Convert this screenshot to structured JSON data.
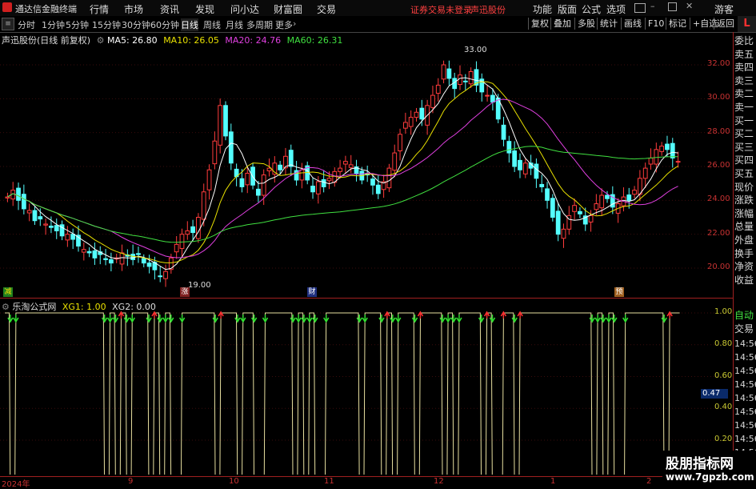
{
  "titlebar": {
    "app_name": "通达信金融终端",
    "menus": [
      "行情",
      "市场",
      "资讯",
      "发现",
      "问小达",
      "财富圈",
      "交易"
    ],
    "notice": "证券交易未登录",
    "stock_name": "声迅股份",
    "right_menus": [
      "功能",
      "版面",
      "公式",
      "选项"
    ],
    "user": "游客",
    "colors": {
      "notice": "#ff4040",
      "accent": "#ff3030"
    }
  },
  "toolbar": {
    "periods": [
      "分时",
      "1分钟",
      "5分钟",
      "15分钟",
      "30分钟",
      "60分钟",
      "日线",
      "周线",
      "月线",
      "多周期",
      "更多"
    ],
    "selected_period": "日线",
    "right_buttons": [
      "复权",
      "叠加",
      "多股",
      "统计",
      "画线",
      "F10",
      "标记",
      "+自选",
      "返回"
    ]
  },
  "main_chart": {
    "title": "声迅股份(日线 前复权)",
    "ma": [
      {
        "label": "MA5: 26.80",
        "color": "#ffffff"
      },
      {
        "label": "MA10: 26.05",
        "color": "#e8e000"
      },
      {
        "label": "MA20: 24.76",
        "color": "#e040e0"
      },
      {
        "label": "MA60: 26.31",
        "color": "#40e040"
      }
    ],
    "high_label": "33.00",
    "low_label": "19.00",
    "markers": [
      "减",
      "涨",
      "财",
      "预"
    ],
    "y_ticks": [
      "32.00",
      "30.00",
      "28.00",
      "26.00",
      "24.00",
      "22.00",
      "20.00"
    ]
  },
  "sub_chart": {
    "title": "乐淘公式网",
    "xg1": "XG1: 1.00",
    "xg2": "XG2: 0.00",
    "y_ticks": [
      "1.00",
      "0.80",
      "0.60",
      "0.40",
      "0.20"
    ],
    "cursor_value": "0.47"
  },
  "x_axis": [
    "2024年",
    "9",
    "10",
    "11",
    "12",
    "1",
    "2"
  ],
  "right_panel": {
    "labels": [
      "委比",
      "卖五",
      "卖四",
      "卖三",
      "卖二",
      "卖一",
      "买一",
      "买二",
      "买三",
      "买四",
      "买五",
      "现价",
      "涨跌",
      "涨幅",
      "总量",
      "外盘",
      "换手",
      "净资",
      "收益"
    ],
    "sub_labels": [
      "自动",
      "交易"
    ],
    "times": [
      "14:56",
      "14:56",
      "14:56",
      "14:56",
      "14:56",
      "14:56",
      "14:56",
      "14:56",
      "14:56",
      "14:56"
    ],
    "corner": "L"
  },
  "watermark": {
    "text": "股朋指标网",
    "url": "www.7gpzb.com"
  },
  "chart_data": [
    {
      "type": "candlestick",
      "title": "",
      "ylim": [
        19.0,
        33.5
      ],
      "close": [
        24.2,
        24.6,
        24.0,
        23.5,
        23.4,
        22.8,
        22.9,
        22.6,
        22.4,
        22.2,
        21.9,
        22.0,
        21.7,
        21.3,
        21.1,
        20.9,
        20.6,
        20.8,
        20.5,
        20.3,
        20.6,
        20.9,
        20.7,
        20.5,
        20.8,
        20.3,
        20.1,
        19.9,
        19.5,
        19.8,
        20.6,
        21.4,
        22.0,
        22.2,
        22.1,
        23.0,
        24.5,
        25.8,
        27.5,
        29.6,
        27.8,
        26.2,
        25.4,
        24.8,
        25.6,
        24.9,
        24.3,
        25.5,
        25.9,
        26.2,
        25.8,
        26.6,
        26.0,
        25.2,
        25.8,
        25.2,
        24.5,
        25.1,
        24.8,
        25.3,
        25.7,
        25.9,
        26.3,
        26.1,
        25.6,
        25.2,
        25.5,
        24.9,
        24.4,
        25.1,
        25.9,
        26.8,
        27.9,
        28.6,
        28.9,
        29.2,
        28.8,
        29.6,
        30.2,
        30.8,
        32.0,
        31.2,
        30.6,
        31.4,
        31.0,
        31.6,
        30.8,
        30.4,
        30.2,
        29.8,
        28.8,
        27.6,
        26.8,
        26.0,
        25.8,
        26.2,
        25.9,
        25.3,
        24.8,
        24.0,
        23.0,
        22.0,
        22.3,
        23.1,
        23.7,
        23.2,
        22.6,
        23.1,
        23.8,
        24.3,
        24.1,
        23.6,
        23.8,
        24.2,
        24.0,
        24.6,
        25.3,
        25.9,
        26.5,
        27.0,
        27.2,
        27.0,
        26.5,
        26.3
      ],
      "ma_series": [
        {
          "name": "MA5",
          "value_last": 26.8
        },
        {
          "name": "MA10",
          "value_last": 26.05
        },
        {
          "name": "MA20",
          "value_last": 24.76
        },
        {
          "name": "MA60",
          "value_last": 26.31
        }
      ],
      "annotations": [
        {
          "text": "33.00",
          "type": "high"
        },
        {
          "text": "19.00",
          "type": "low"
        }
      ]
    },
    {
      "type": "line",
      "title": "",
      "ylim": [
        0,
        1
      ],
      "series": [
        {
          "name": "XG1",
          "values": [
            1,
            0,
            1,
            1,
            1,
            1,
            1,
            1,
            1,
            1,
            1,
            1,
            1,
            1,
            1,
            1,
            1,
            1,
            0,
            1,
            0,
            1,
            0,
            1,
            1,
            1,
            0,
            1,
            0,
            1,
            0,
            0,
            1,
            1,
            1,
            1,
            1,
            1,
            0,
            1,
            1,
            1,
            0,
            1,
            1,
            0,
            0,
            1,
            1,
            1,
            1,
            1,
            0,
            1,
            0,
            1,
            0,
            0,
            1,
            1,
            1,
            1,
            1,
            1,
            0,
            1,
            1,
            1,
            0,
            1,
            0,
            1,
            1,
            1,
            0,
            1,
            1,
            1,
            1,
            0,
            1,
            0,
            1,
            1,
            1,
            1,
            0,
            1,
            0,
            0,
            1,
            1,
            0,
            1,
            1,
            1,
            1,
            1,
            1,
            1,
            1,
            1,
            1,
            1,
            1,
            1,
            0,
            1,
            0,
            1,
            0,
            0,
            1,
            1,
            1,
            1,
            1,
            1,
            1,
            0,
            1,
            1
          ]
        }
      ],
      "signals_up": 14,
      "signals_down": 21
    }
  ]
}
